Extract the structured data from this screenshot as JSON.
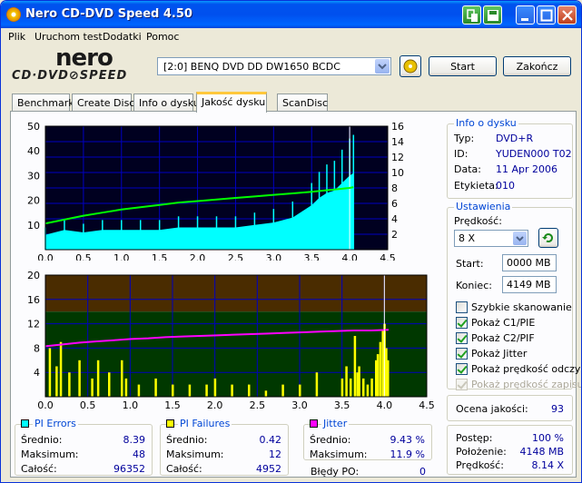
{
  "window": {
    "title": "Nero CD-DVD Speed 4.50"
  },
  "menu": [
    "Plik",
    "Uruchom test",
    "Dodatki",
    "Pomoc"
  ],
  "logo": {
    "brand": "nero",
    "product": "CD·DVD⊘SPEED"
  },
  "drive": {
    "selected": "[2:0]  BENQ DVD DD DW1650 BCDC"
  },
  "buttons": {
    "start": "Start",
    "close": "Zakończ"
  },
  "tabs": [
    "Benchmark",
    "Create Disc",
    "Info o dysku",
    "Jakość dysku",
    "ScanDisc"
  ],
  "active_tab": 3,
  "disc_info": {
    "title": "Info o dysku",
    "rows": [
      {
        "k": "Typ:",
        "v": "DVD+R"
      },
      {
        "k": "ID:",
        "v": "YUDEN000 T02"
      },
      {
        "k": "Data:",
        "v": "11 Apr 2006"
      },
      {
        "k": "Etykieta:",
        "v": "010"
      }
    ]
  },
  "settings": {
    "title": "Ustawienia",
    "speed_label": "Prędkość:",
    "speed": "8 X",
    "start_label": "Start:",
    "start": "0000 MB",
    "end_label": "Koniec:",
    "end": "4149 MB",
    "checks": [
      {
        "label": "Szybkie skanowanie",
        "on": false,
        "dis": false
      },
      {
        "label": "Pokaż C1/PIE",
        "on": true,
        "dis": false
      },
      {
        "label": "Pokaż C2/PIF",
        "on": true,
        "dis": false
      },
      {
        "label": "Pokaż Jitter",
        "on": true,
        "dis": false
      },
      {
        "label": "Pokaż prędkość odczy",
        "on": true,
        "dis": false
      },
      {
        "label": "Pokaż prędkość zapisu",
        "on": true,
        "dis": true
      }
    ]
  },
  "quality": {
    "label": "Ocena jakości:",
    "value": "93"
  },
  "progress": {
    "rows": [
      {
        "k": "Postęp:",
        "v": "100 %"
      },
      {
        "k": "Położenie:",
        "v": "4148 MB"
      },
      {
        "k": "Prędkość:",
        "v": "8.14 X"
      }
    ]
  },
  "stats": {
    "pie": {
      "title": "PI Errors",
      "color": "#00FFFF",
      "rows": [
        {
          "k": "Średnio:",
          "v": "8.39"
        },
        {
          "k": "Maksimum:",
          "v": "48"
        },
        {
          "k": "Całość:",
          "v": "96352"
        }
      ]
    },
    "pif": {
      "title": "PI Failures",
      "color": "#FFFF00",
      "rows": [
        {
          "k": "Średnio:",
          "v": "0.42"
        },
        {
          "k": "Maksimum:",
          "v": "12"
        },
        {
          "k": "Całość:",
          "v": "4952"
        }
      ]
    },
    "jitter": {
      "title": "Jitter",
      "color": "#FF00FF",
      "rows": [
        {
          "k": "Średnio:",
          "v": "9.43 %"
        },
        {
          "k": "Maksimum:",
          "v": "11.9 %"
        }
      ],
      "po_label": "Błędy PO:",
      "po_value": "0"
    }
  },
  "chart_data": [
    {
      "type": "area",
      "title": "PI Errors",
      "x": [
        0,
        0.25,
        0.5,
        0.75,
        1,
        1.25,
        1.5,
        1.75,
        2,
        2.25,
        2.5,
        2.75,
        3,
        3.25,
        3.5,
        3.6,
        3.7,
        3.8,
        3.9,
        4.0,
        4.05
      ],
      "values": [
        6,
        8,
        7,
        8,
        8,
        8,
        8,
        9,
        9,
        9,
        9,
        10,
        11,
        13,
        18,
        21,
        23,
        24,
        27,
        30,
        31
      ],
      "xlim": [
        0,
        4.5
      ],
      "ylim": [
        0,
        50
      ],
      "y2lim": [
        0,
        16
      ],
      "xticks": [
        "0.0",
        "0.5",
        "1.0",
        "1.5",
        "2.0",
        "2.5",
        "3.0",
        "3.5",
        "4.0",
        "4.5"
      ],
      "yticks": [
        "10",
        "20",
        "30",
        "40",
        "50"
      ],
      "y2ticks": [
        "2",
        "4",
        "6",
        "8",
        "10",
        "12",
        "14",
        "16"
      ],
      "series": [
        {
          "values": "area",
          "color": "#00FFFF"
        },
        {
          "color": "#00FF00",
          "y2": [
            3.4,
            3.9,
            4.4,
            4.8,
            5.2,
            5.5,
            5.8,
            6.1,
            6.3,
            6.5,
            6.7,
            6.9,
            7.1,
            7.3,
            7.5,
            7.6,
            7.7,
            7.8,
            7.9,
            8.0,
            8.1
          ]
        }
      ]
    },
    {
      "type": "bar",
      "title": "PI Failures / Jitter",
      "xlim": [
        0,
        4.5
      ],
      "ylim": [
        0,
        20
      ],
      "xticks": [
        "0.0",
        "0.5",
        "1.0",
        "1.5",
        "2.0",
        "2.5",
        "3.0",
        "3.5",
        "4.0",
        "4.5"
      ],
      "yticks": [
        "4",
        "8",
        "12",
        "16",
        "20"
      ],
      "bars": [
        {
          "x": 0.05,
          "v": 8
        },
        {
          "x": 0.13,
          "v": 5
        },
        {
          "x": 0.18,
          "v": 9
        },
        {
          "x": 0.28,
          "v": 4
        },
        {
          "x": 0.4,
          "v": 6
        },
        {
          "x": 0.55,
          "v": 3
        },
        {
          "x": 0.62,
          "v": 6
        },
        {
          "x": 0.75,
          "v": 4
        },
        {
          "x": 0.9,
          "v": 6
        },
        {
          "x": 0.95,
          "v": 3
        },
        {
          "x": 1.1,
          "v": 2
        },
        {
          "x": 1.3,
          "v": 3
        },
        {
          "x": 1.5,
          "v": 2
        },
        {
          "x": 1.7,
          "v": 2
        },
        {
          "x": 1.9,
          "v": 2
        },
        {
          "x": 2.0,
          "v": 3
        },
        {
          "x": 2.2,
          "v": 2
        },
        {
          "x": 2.4,
          "v": 2
        },
        {
          "x": 2.6,
          "v": 1
        },
        {
          "x": 2.8,
          "v": 2
        },
        {
          "x": 3.0,
          "v": 2
        },
        {
          "x": 3.2,
          "v": 4
        },
        {
          "x": 3.5,
          "v": 3
        },
        {
          "x": 3.55,
          "v": 5
        },
        {
          "x": 3.6,
          "v": 3
        },
        {
          "x": 3.65,
          "v": 10
        },
        {
          "x": 3.68,
          "v": 4
        },
        {
          "x": 3.7,
          "v": 5
        },
        {
          "x": 3.75,
          "v": 3
        },
        {
          "x": 3.8,
          "v": 2
        },
        {
          "x": 3.85,
          "v": 3
        },
        {
          "x": 3.9,
          "v": 6
        },
        {
          "x": 3.92,
          "v": 7
        },
        {
          "x": 3.95,
          "v": 9
        },
        {
          "x": 3.98,
          "v": 11
        },
        {
          "x": 4.0,
          "v": 12
        },
        {
          "x": 4.02,
          "v": 8
        },
        {
          "x": 4.04,
          "v": 6
        }
      ],
      "jitter": [
        8.3,
        8.6,
        8.9,
        9.1,
        9.3,
        9.5,
        9.6,
        9.8,
        9.9,
        10.0,
        10.1,
        10.2,
        10.3,
        10.4,
        10.5,
        10.6,
        10.7,
        10.8,
        10.9,
        10.9,
        11.0
      ]
    }
  ]
}
